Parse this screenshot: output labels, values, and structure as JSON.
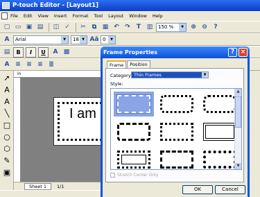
{
  "window": {
    "title": "P-touch Editor - [Layout1]"
  },
  "menubar": {
    "items": [
      "File",
      "Edit",
      "View",
      "Insert",
      "Format",
      "Tool",
      "Layout",
      "Window",
      "Help"
    ]
  },
  "toolbar": {
    "zoom": "150 %"
  },
  "format_bar": {
    "font": "Arial",
    "size": "18",
    "spacing": "0"
  },
  "style_buttons": {
    "bold": "B",
    "italic": "I",
    "underline": "U"
  },
  "canvas": {
    "text": "I am"
  },
  "sheetbar": {
    "sheet_tab": "Sheet 1",
    "page": "1/1"
  },
  "dialog": {
    "title": "Frame Properties",
    "tabs": [
      "Frame",
      "Position"
    ],
    "category_label": "Category:",
    "category_value": "Thin Frames",
    "style_label": "Style:",
    "stretch_label": "Stretch Center Only",
    "ok_label": "OK",
    "cancel_label": "Cancel",
    "help_label": "?",
    "close_label": "×"
  },
  "colors": {
    "titlebar": "#0a3ec9",
    "selection": "#8aa5e6",
    "category_highlight": "#1f4fbf"
  }
}
